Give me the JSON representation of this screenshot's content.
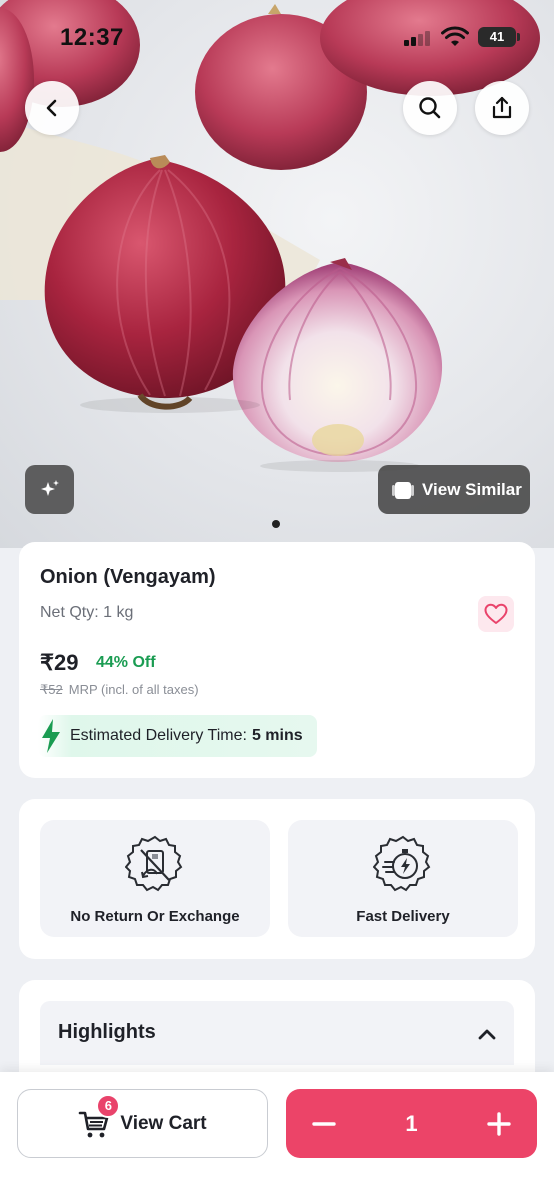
{
  "status_bar": {
    "time": "12:37",
    "battery": "41"
  },
  "hero": {
    "view_similar_label": "View Similar"
  },
  "product": {
    "name": "Onion (Vengayam)",
    "net_qty": "Net Qty: 1 kg",
    "price": "₹29",
    "discount": "44% Off",
    "mrp": "₹52",
    "mrp_note": "MRP (incl. of all taxes)",
    "delivery_label": "Estimated Delivery Time:",
    "delivery_time": "5 mins"
  },
  "features": [
    {
      "label": "No Return Or Exchange",
      "icon": "no-return-icon"
    },
    {
      "label": "Fast Delivery",
      "icon": "fast-delivery-icon"
    }
  ],
  "highlights": {
    "title": "Highlights"
  },
  "bottom_bar": {
    "cart_label": "View Cart",
    "cart_count": "6",
    "quantity": "1"
  },
  "colors": {
    "accent": "#ec4468",
    "discount_green": "#1a9c52",
    "delivery_bg": "#dff7eb",
    "fav_bg": "#fde8ee"
  }
}
